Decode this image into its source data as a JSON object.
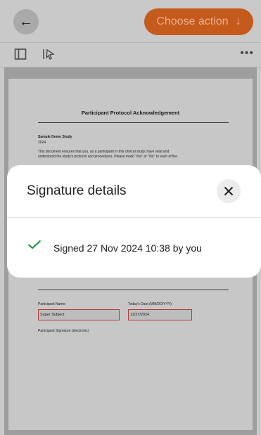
{
  "header": {
    "back_icon": "arrow-left-icon",
    "action_label": "Choose action",
    "action_icon": "arrow-down-icon"
  },
  "toolbar": {
    "panel_icon": "sidebar-panel-icon",
    "select_icon": "select-cursor-icon",
    "more_icon": "more-horizontal-icon"
  },
  "document": {
    "title": "Participant Protocol Acknowledgement",
    "study_name": "Sample Demo Study",
    "study_year": "2024",
    "body_line1": "This document ensures that you, as a participant in this clinical study, have read and",
    "body_line2": "understand the study's protocol and procedures. Please mark \"Yes\" or \"No\" to each of the",
    "participant_name_label": "Participant Name:",
    "participant_name_value": "Super Subject",
    "date_label": "Today's Date (MM/DD/YYY):",
    "date_value": "11/27/2024",
    "signature_label": "Participant Signature (electronic)"
  },
  "modal": {
    "title": "Signature details",
    "close_icon": "close-icon",
    "status_icon": "checkmark-icon",
    "status_color": "#1a8f3c",
    "signed_text": "Signed 27 Nov 2024 10:38 by you"
  }
}
